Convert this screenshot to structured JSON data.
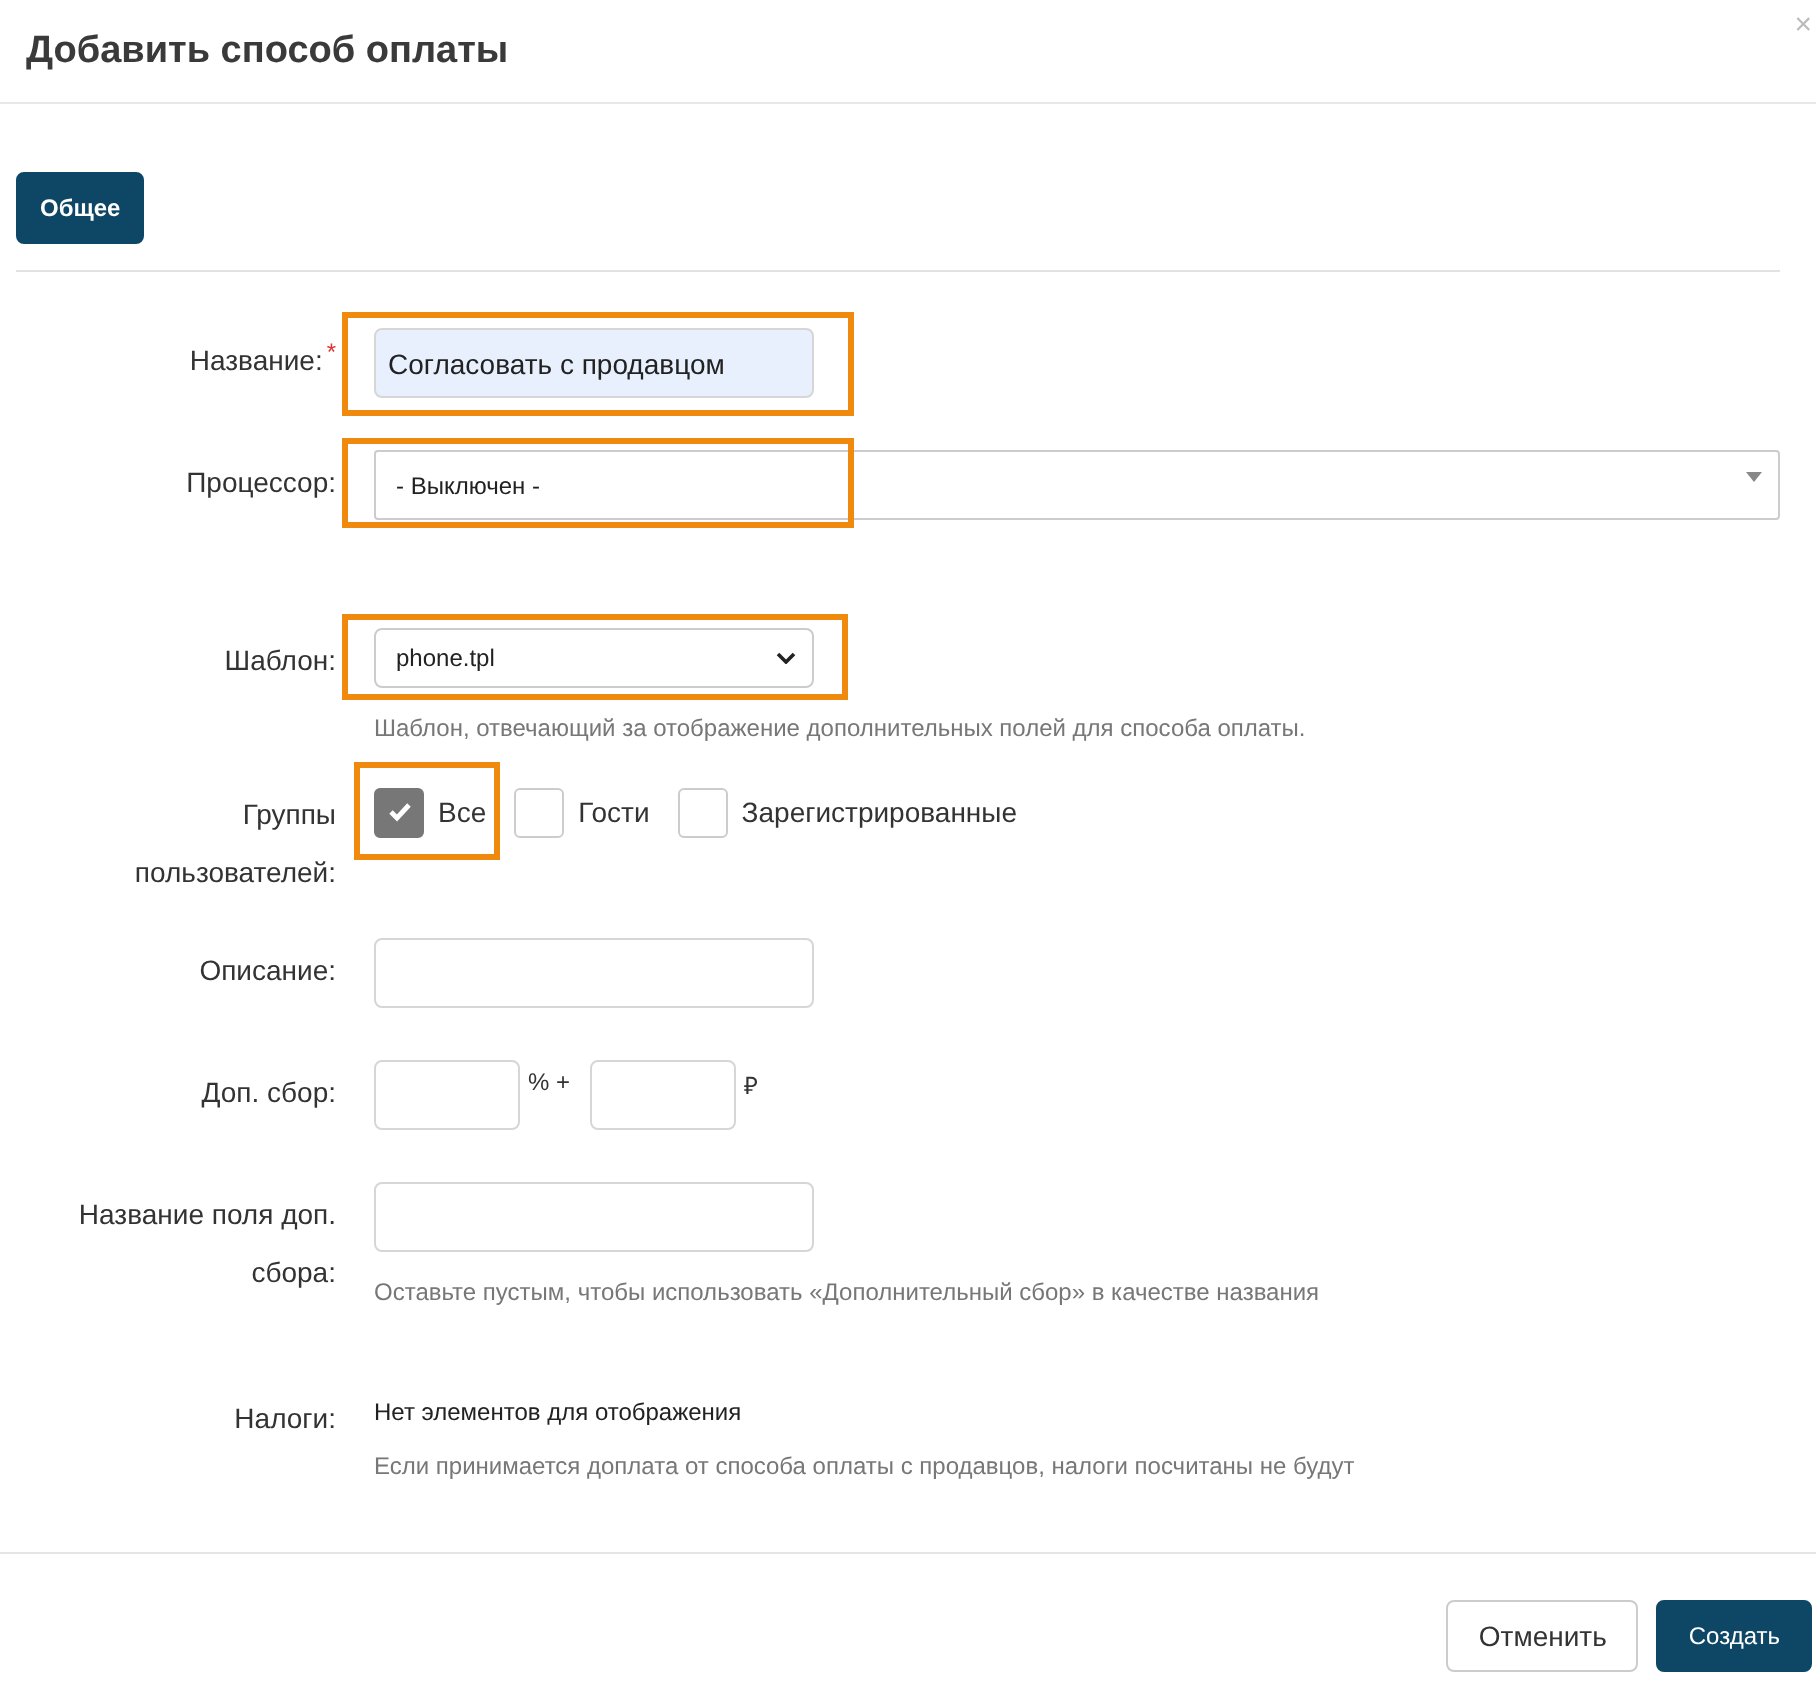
{
  "dialog": {
    "title": "Добавить способ оплаты",
    "close": "×"
  },
  "tabs": [
    {
      "label": "Общее",
      "selected": true
    }
  ],
  "fields": [
    {
      "kind": "text",
      "label": "Название:",
      "required_mark": "*",
      "value": "Согласовать с продавцом",
      "highlighted": true
    },
    {
      "kind": "select-wide",
      "label": "Процессор:",
      "value": "- Выключен -",
      "highlighted": true
    },
    {
      "kind": "select",
      "label": "Шаблон:",
      "value": "phone.tpl",
      "hint": "Шаблон, отвечающий за отображение дополнительных полей для способа оплаты.",
      "highlighted": true
    },
    {
      "kind": "checkboxes",
      "label": "Группы пользователей:",
      "options": [
        {
          "label": "Все",
          "checked": true,
          "highlighted": true
        },
        {
          "label": "Гости",
          "checked": false,
          "highlighted": false
        },
        {
          "label": "Зарегистрированные",
          "checked": false,
          "highlighted": false
        }
      ]
    },
    {
      "kind": "text",
      "label": "Описание:"
    },
    {
      "kind": "fee",
      "label": "Доп. сбор:",
      "percent_unit": "% +",
      "currency_unit": "₽"
    },
    {
      "kind": "text",
      "label": "Название поля доп. сбора:",
      "hint": "Оставьте пустым, чтобы использовать «Дополнительный сбор» в качестве названия"
    },
    {
      "kind": "static",
      "label": "Налоги:",
      "text": "Нет элементов для отображения",
      "hint": "Если принимается доплата от способа оплаты с продавцов, налоги посчитаны не будут"
    }
  ],
  "buttons": [
    {
      "label": "Отменить",
      "kind": "secondary"
    },
    {
      "label": "Создать",
      "kind": "primary"
    }
  ]
}
